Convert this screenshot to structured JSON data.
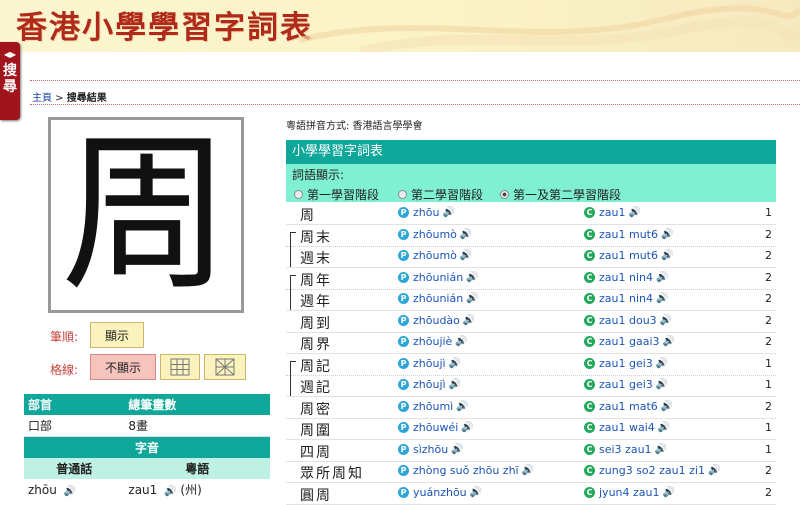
{
  "site_title": "香港小學學習字詞表",
  "search_tab": {
    "arrows": "◀▶",
    "label": "搜尋"
  },
  "breadcrumb": {
    "home": "主頁",
    "sep": " > ",
    "current": "搜尋結果"
  },
  "character": "周",
  "stroke_order": {
    "label": "筆順:",
    "button": "顯示"
  },
  "grid_lines": {
    "label": "格線:",
    "hide_button": "不顯示"
  },
  "left_table": {
    "radical_header": "部首",
    "strokes_header": "總筆畫數",
    "radical": "口部",
    "strokes": "8畫",
    "sound_header": "字音",
    "putonghua_header": "普通話",
    "cantonese_header": "粵語",
    "putonghua": "zhōu",
    "cantonese": "zau1",
    "cantonese_extra": "(州)"
  },
  "jyutping_note": "粵語拼音方式: 香港語言學學會",
  "word_table": {
    "title": "小學學習字詞表",
    "display_label": "詞語顯示:",
    "options": [
      "第一學習階段",
      "第二學習階段",
      "第一及第二學習階段"
    ],
    "selected": 2,
    "rows": [
      {
        "word": "周",
        "pinyin": "zhōu",
        "jyutping": "zau1",
        "stage": "1"
      },
      {
        "word": "周末",
        "pinyin": "zhōumò",
        "jyutping": "zau1 mut6",
        "stage": "2"
      },
      {
        "word": "週末",
        "pinyin": "zhōumò",
        "jyutping": "zau1 mut6",
        "stage": "2"
      },
      {
        "word": "周年",
        "pinyin": "zhōunián",
        "jyutping": "zau1 nin4",
        "stage": "2"
      },
      {
        "word": "週年",
        "pinyin": "zhōunián",
        "jyutping": "zau1 nin4",
        "stage": "2"
      },
      {
        "word": "周到",
        "pinyin": "zhōudào",
        "jyutping": "zau1 dou3",
        "stage": "2"
      },
      {
        "word": "周界",
        "pinyin": "zhōujiè",
        "jyutping": "zau1 gaai3",
        "stage": "2"
      },
      {
        "word": "周記",
        "pinyin": "zhōujì",
        "jyutping": "zau1 gei3",
        "stage": "1"
      },
      {
        "word": "週記",
        "pinyin": "zhōujì",
        "jyutping": "zau1 gei3",
        "stage": "1"
      },
      {
        "word": "周密",
        "pinyin": "zhōumì",
        "jyutping": "zau1 mat6",
        "stage": "2"
      },
      {
        "word": "周圍",
        "pinyin": "zhōuwéi",
        "jyutping": "zau1 wai4",
        "stage": "1"
      },
      {
        "word": "四周",
        "pinyin": "sìzhōu",
        "jyutping": "sei3 zau1",
        "stage": "1"
      },
      {
        "word": "眾所周知",
        "pinyin": "zhòng suǒ zhōu zhī",
        "jyutping": "zung3 so2 zau1 zi1",
        "stage": "2"
      },
      {
        "word": "圓周",
        "pinyin": "yuánzhōu",
        "jyutping": "jyun4 zau1",
        "stage": "2"
      }
    ]
  },
  "badges": {
    "putonghua": "P",
    "cantonese": "C"
  },
  "colors": {
    "accent_red": "#b02a1a",
    "teal": "#0fa79a",
    "mint": "#7ff0d2",
    "link_blue": "#1b55b8"
  }
}
